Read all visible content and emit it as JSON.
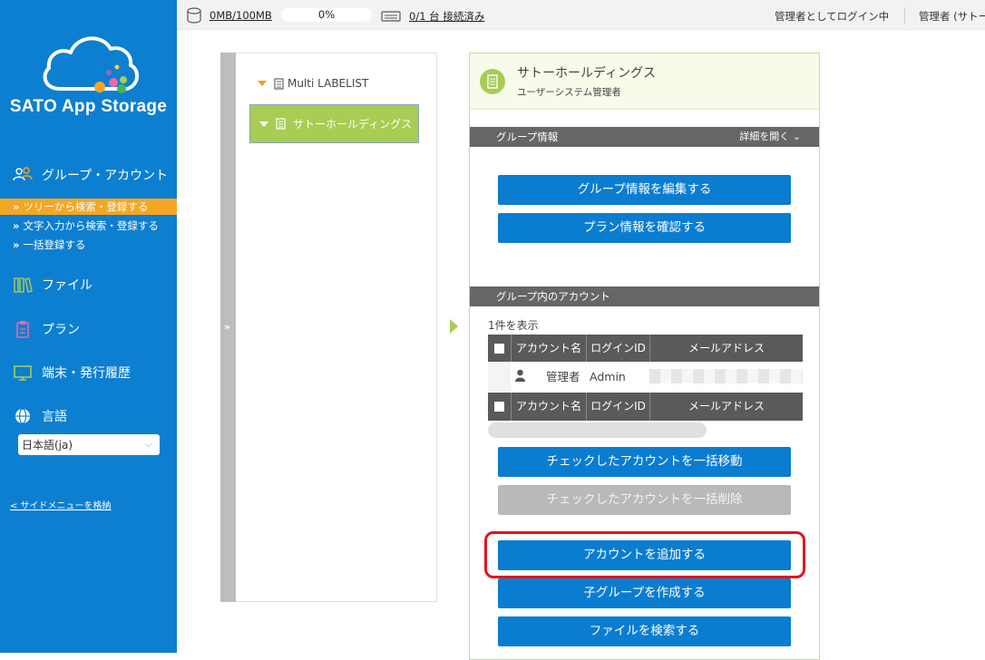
{
  "app": {
    "brand": "SATO App Storage"
  },
  "topbar": {
    "storage": "0MB/100MB",
    "quota_percent": "0%",
    "devices": "0/1 台 接続済み",
    "login_status": "管理者としてログイン中",
    "user": "管理者 (サトー"
  },
  "sidebar": {
    "group_account": "グループ・アカウント",
    "sub_items": [
      "ツリーから検索・登録する",
      "文字入力から検索・登録する",
      "一括登録する"
    ],
    "file": "ファイル",
    "plan": "プラン",
    "terminal": "端末・発行履歴",
    "language": "言語",
    "language_value": "日本語(ja)",
    "collapse": "< サイドメニューを格納"
  },
  "tree": {
    "root": "Multi LABELIST",
    "selected": "サトーホールディングス",
    "handle_glyph": "»"
  },
  "detail": {
    "title": "サトーホールディングス",
    "subtitle": "ユーザーシステム管理者",
    "group_info": {
      "header": "グループ情報",
      "toggle": "詳細を開く ⌄",
      "edit_btn": "グループ情報を編集する",
      "plan_btn": "プラン情報を確認する"
    },
    "accounts": {
      "header": "グループ内のアカウント",
      "count": "1件を表示",
      "columns": [
        "アカウント名",
        "ログインID",
        "メールアドレス"
      ],
      "rows": [
        {
          "name": "管理者",
          "login": "Admin"
        }
      ],
      "move_btn": "チェックしたアカウントを一括移動",
      "delete_btn": "チェックしたアカウントを一括削除",
      "add_btn": "アカウントを追加する",
      "child_btn": "子グループを作成する",
      "search_btn": "ファイルを検索する"
    }
  },
  "colors": {
    "sidebar_bg": "#0d7fd0",
    "active_item": "#f5a623",
    "primary_button": "#0a7dd1",
    "tree_selected": "#a9cc54",
    "highlight": "#e8111d"
  }
}
